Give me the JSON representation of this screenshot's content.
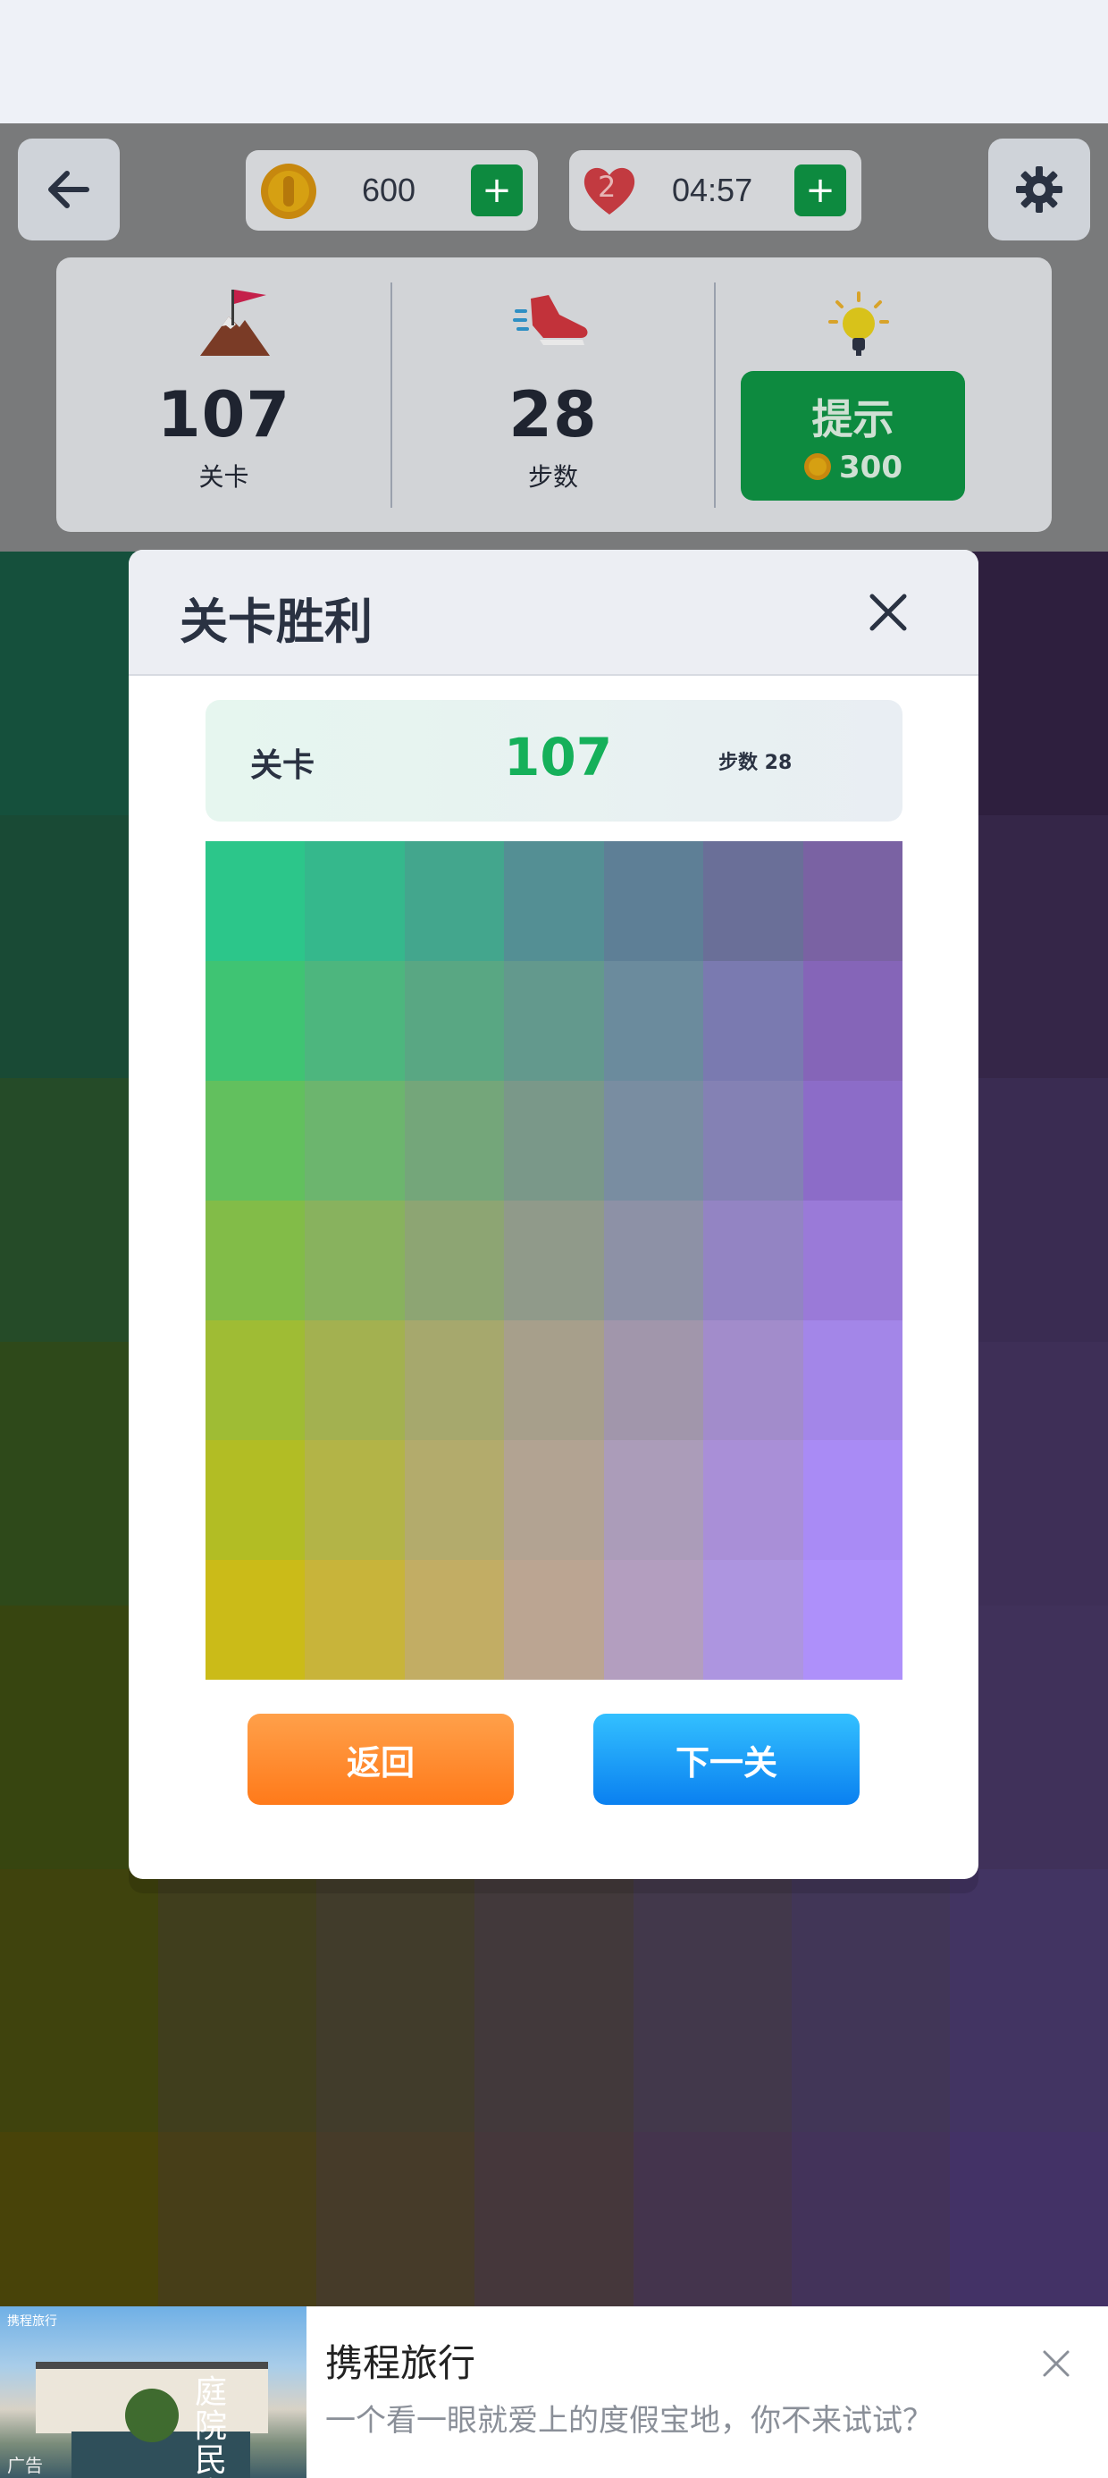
{
  "topbar": {
    "back_icon": "arrow-left-icon",
    "coins": "600",
    "lives_count": "2",
    "lives_timer": "04:57",
    "plus_label": "+",
    "settings_icon": "gear-icon"
  },
  "stats": {
    "level_value": "107",
    "level_label": "关卡",
    "level_icon": "mountain-flag-icon",
    "steps_value": "28",
    "steps_label": "步数",
    "steps_icon": "sneaker-icon",
    "hint_icon": "lightbulb-icon",
    "hint_label": "提示",
    "hint_cost": "300"
  },
  "dialog": {
    "title": "关卡胜利",
    "close_icon": "close-icon",
    "result_label": "关卡",
    "result_level": "107",
    "result_steps": "步数 28",
    "back_button": "返回",
    "next_button": "下一关"
  },
  "board_colors": [
    [
      "#2cc68a",
      "#35b88c",
      "#43a68d",
      "#548f94",
      "#5e7f96",
      "#6a6f98",
      "#7a62a3"
    ],
    [
      "#3fc473",
      "#4db67e",
      "#59a783",
      "#63998d",
      "#6b8b9d",
      "#7a7ab0",
      "#8565b8"
    ],
    [
      "#62c05e",
      "#6cb56e",
      "#74a67a",
      "#7a9889",
      "#798da1",
      "#8481b4",
      "#8c6cc8"
    ],
    [
      "#82bc48",
      "#88b25e",
      "#8da573",
      "#909a8a",
      "#8d91a6",
      "#9384c3",
      "#9a7ad8"
    ],
    [
      "#9fbc34",
      "#a3b150",
      "#a6a86d",
      "#a79f8b",
      "#a196ab",
      "#a28ccb",
      "#a386e8"
    ],
    [
      "#b2bd24",
      "#b3b447",
      "#b3ab6c",
      "#b2a392",
      "#ab9cb9",
      "#a98fd7",
      "#a98bf5"
    ],
    [
      "#cbbb18",
      "#c8b43a",
      "#c2ad64",
      "#bba592",
      "#b39ebf",
      "#ad95e0",
      "#ae90fa"
    ]
  ],
  "background_board_colors": [
    [
      "#2aa078",
      "#2c8a70",
      "#356f62",
      "#3f5f6b",
      "#4a4d72",
      "#523f76",
      "#5c3f7c"
    ],
    [
      "#33946b",
      "#3b8465",
      "#476f64",
      "#4e5f70",
      "#565374",
      "#5e4a80",
      "#6a4c91"
    ],
    [
      "#4a9650",
      "#528556",
      "#5a7661",
      "#5f6a72",
      "#645f7f",
      "#6b5891",
      "#7458a4"
    ],
    [
      "#5d9234",
      "#637f47",
      "#6b7459",
      "#6f6d72",
      "#716585",
      "#755f9a",
      "#7c5eae"
    ],
    [
      "#6f8b20",
      "#738040",
      "#7a7958",
      "#7d7274",
      "#7d6c8c",
      "#7d66a2",
      "#8062b5"
    ],
    [
      "#7f861a",
      "#817d3a",
      "#837856",
      "#857377",
      "#847097",
      "#826caf",
      "#8468c4"
    ],
    [
      "#918612",
      "#8f7d30",
      "#8c7652",
      "#8a6f77",
      "#88699a",
      "#8667b5",
      "#8665cc"
    ]
  ],
  "ad": {
    "title": "携程旅行",
    "description": "一个看一眼就爱上的度假宝地，你不来试试？",
    "image_text": "庭院民宿",
    "brand_text": "携程旅行",
    "ad_tag": "广告",
    "close_icon": "close-icon"
  }
}
